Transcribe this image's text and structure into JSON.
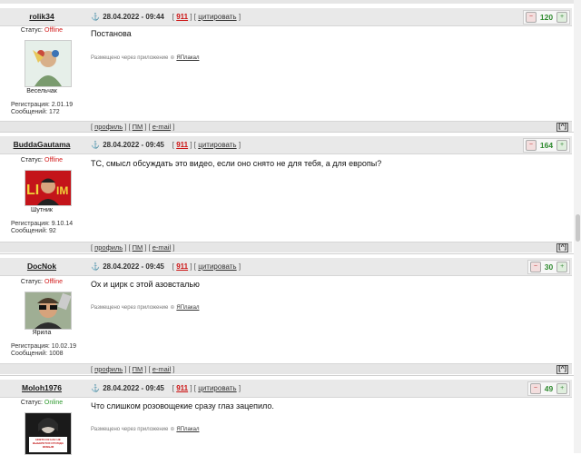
{
  "posts": [
    {
      "author": "rolik34",
      "date": "28.04.2022 - 09:44",
      "num": "911",
      "quote": "цитировать",
      "status_label": "Статус: ",
      "status": "Offline",
      "rank": "Весельчак",
      "reg": "Регистрация: 2.01.19",
      "msgs": "Сообщений: 172",
      "text": "Постанова",
      "rating": "120"
    },
    {
      "author": "BuddaGautama",
      "date": "28.04.2022 - 09:45",
      "num": "911",
      "quote": "цитировать",
      "status_label": "Статус: ",
      "status": "Offline",
      "rank": "Шутник",
      "reg": "Регистрация: 9.10.14",
      "msgs": "Сообщений: 92",
      "text": "ТС, смысл обсуждать это видео, если оно снято не для тебя, а для европы?",
      "rating": "164"
    },
    {
      "author": "DocNok",
      "date": "28.04.2022 - 09:45",
      "num": "911",
      "quote": "цитировать",
      "status_label": "Статус: ",
      "status": "Offline",
      "rank": "Ярила",
      "reg": "Регистрация: 10.02.19",
      "msgs": "Сообщений: 1008",
      "text": "Ох и цирк с этой азовсталью",
      "rating": "30"
    },
    {
      "author": "Moloh1976",
      "date": "28.04.2022 - 09:45",
      "num": "911",
      "quote": "цитировать",
      "status_label": "Статус: ",
      "status": "Online",
      "text": "Что слишком розовощекие сразу глаз зацепило.",
      "rating": "49"
    }
  ],
  "via_text": "Размещено через приложение",
  "via_app": "ЯПлакал",
  "foot": {
    "profile": "профиль",
    "pm": "ПМ",
    "email": "e-mail",
    "up": "[^]"
  },
  "avatar4_text": "НИКТО ИЗ НАС НЕ ВЫБЕРЕТСЯ ОТСЮДА ЖИВЫМ",
  "colors": {
    "offline": "#d21d1d",
    "online": "#2f9a2f",
    "rating": "#2f8a2f",
    "num": "#cc1111"
  },
  "icons": [
    "anchor-icon",
    "minus-icon",
    "plus-icon",
    "app-icon"
  ]
}
